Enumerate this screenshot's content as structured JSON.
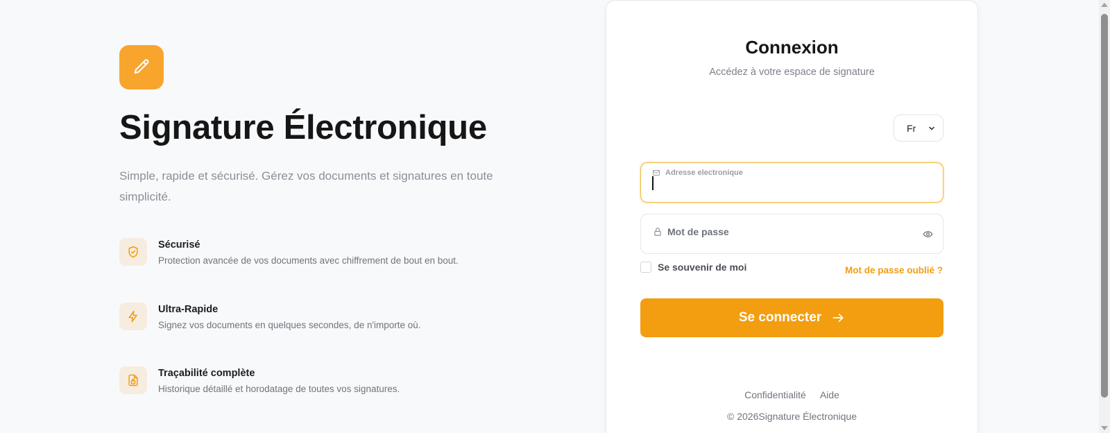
{
  "colors": {
    "accent": "#f39d11",
    "logo_bg": "#f8a52e",
    "feature_icon_bg": "#f7ece0",
    "page_bg": "#f8f9fb"
  },
  "hero": {
    "logo_icon": "pen-icon",
    "title": "Signature Électronique",
    "subtitle": "Simple, rapide et sécurisé. Gérez vos documents et signatures en toute simplicité.",
    "features": [
      {
        "icon": "shield-check-icon",
        "title": "Sécurisé",
        "description": "Protection avancée de vos documents avec chiffrement de bout en bout."
      },
      {
        "icon": "lightning-icon",
        "title": "Ultra-Rapide",
        "description": "Signez vos documents en quelques secondes, de n'importe où."
      },
      {
        "icon": "file-lock-icon",
        "title": "Traçabilité complète",
        "description": "Historique détaillé et horodatage de toutes vos signatures."
      }
    ]
  },
  "login": {
    "title": "Connexion",
    "subtitle": "Accédez à votre espace de signature",
    "language": {
      "selected": "Fr"
    },
    "email": {
      "label": "Adresse electronique",
      "value": "",
      "icon": "mail-icon"
    },
    "password": {
      "label": "Mot de passe",
      "value": "",
      "icon": "lock-icon",
      "toggle_icon": "eye-icon"
    },
    "remember_label": "Se souvenir de moi",
    "forgot_label": "Mot de passe oublié ?",
    "submit_label": "Se connecter",
    "footer": {
      "links": [
        "Confidentialité",
        "Aide"
      ],
      "copyright": "© 2026Signature Électronique"
    }
  }
}
